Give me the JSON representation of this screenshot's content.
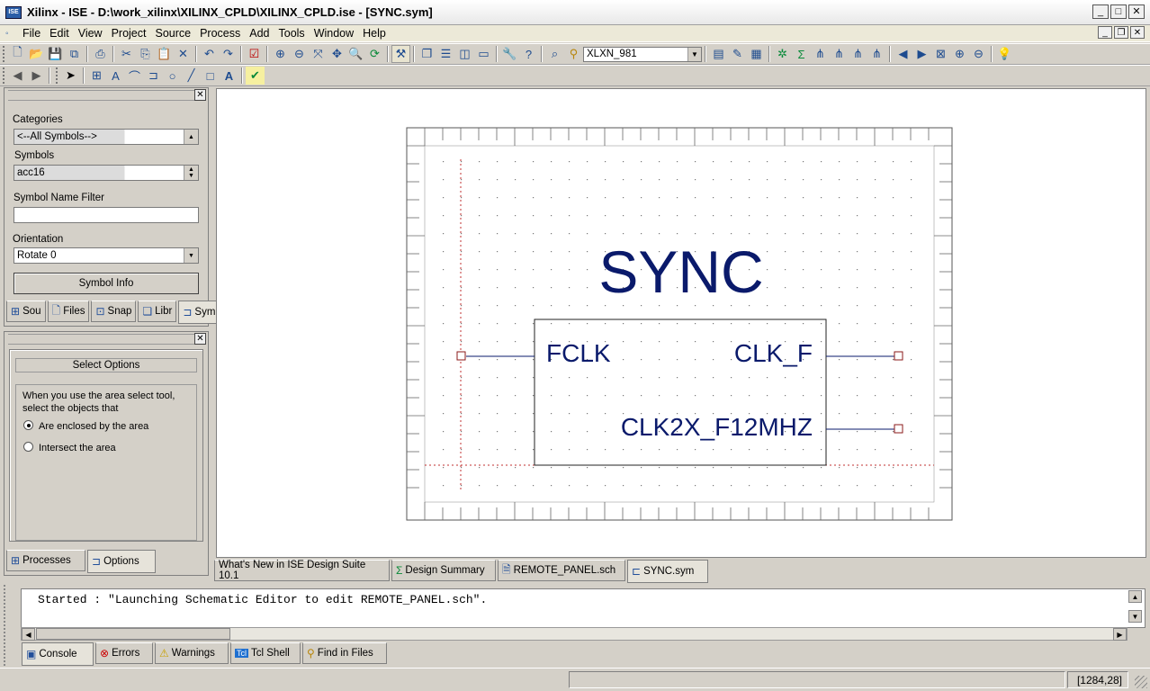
{
  "window": {
    "title": "Xilinx - ISE - D:\\work_xilinx\\XILINX_CPLD\\XILINX_CPLD.ise - [SYNC.sym]",
    "logo_text": "ISE",
    "minimize": "_",
    "maximize": "□",
    "close": "✕"
  },
  "menu": {
    "items": [
      "File",
      "Edit",
      "View",
      "Project",
      "Source",
      "Process",
      "Add",
      "Tools",
      "Window",
      "Help"
    ]
  },
  "toolbar": {
    "net_combo_value": "XLXN_981"
  },
  "symbols_panel": {
    "categories_label": "Categories",
    "categories_value": "<--All Symbols-->",
    "symbols_label": "Symbols",
    "symbols_value": "acc16",
    "filter_label": "Symbol Name Filter",
    "filter_value": "",
    "orientation_label": "Orientation",
    "orientation_value": "Rotate 0",
    "info_button": "Symbol Info",
    "tabs": [
      "Sou",
      "Files",
      "Snap",
      "Libr",
      "Syml"
    ]
  },
  "options_panel": {
    "header": "Select Options",
    "description": "When you use the area select tool, select the objects that",
    "radio_enclosed": "Are enclosed by the area",
    "radio_intersect": "Intersect the area",
    "selected": "enclosed",
    "tabs": [
      "Processes",
      "Options"
    ]
  },
  "schematic": {
    "symbol_name": "SYNC",
    "pins": {
      "left": "FCLK",
      "right_top": "CLK_F",
      "right_bottom": "CLK2X_F12MHZ"
    },
    "colors": {
      "text": "#0a1a6b",
      "guide": "#c03030",
      "pin_box": "#8b1a1a"
    }
  },
  "doc_tabs": [
    "What's New in ISE Design Suite 10.1",
    "Design Summary",
    "REMOTE_PANEL.sch",
    "SYNC.sym"
  ],
  "console": {
    "text": "Started : \"Launching Schematic Editor to edit REMOTE_PANEL.sch\".",
    "tabs": [
      "Console",
      "Errors",
      "Warnings",
      "Tcl Shell",
      "Find in Files"
    ]
  },
  "status": {
    "coords": "[1284,28]"
  }
}
